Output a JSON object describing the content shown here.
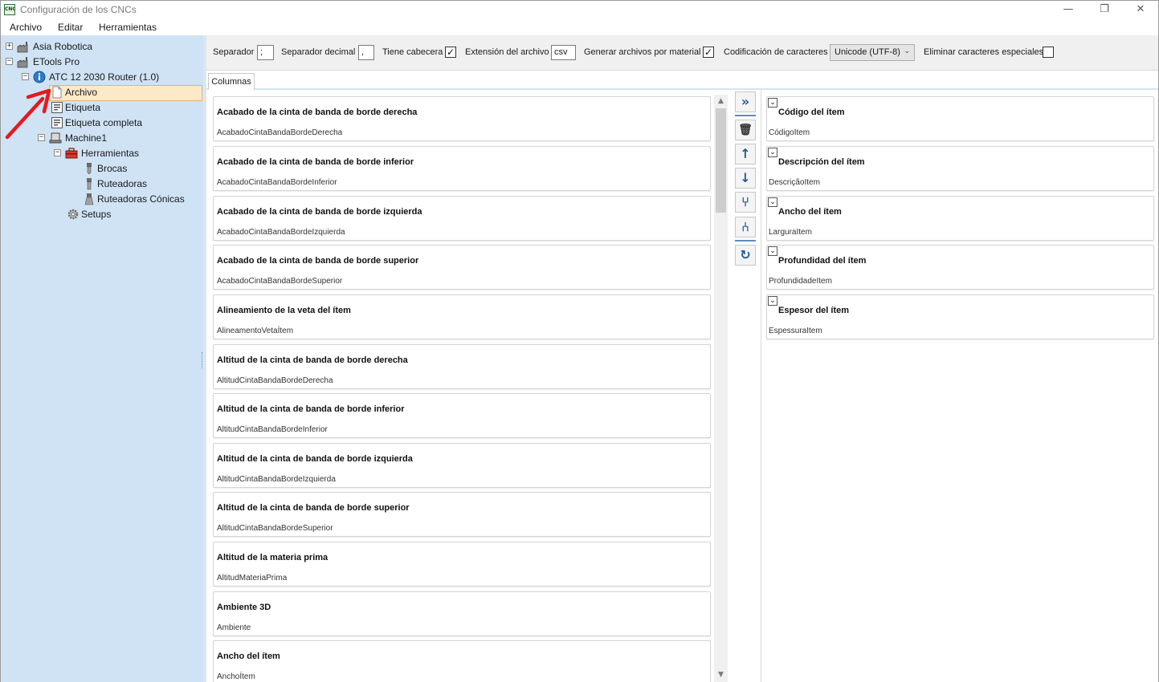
{
  "window": {
    "title": "Configuración de los CNCs",
    "app_icon": "CNC",
    "minimize": "—",
    "restore": "❐",
    "close": "✕"
  },
  "menu": [
    "Archivo",
    "Editar",
    "Herramientas"
  ],
  "tree": {
    "asia": "Asia Robotica",
    "etools": "ETools Pro",
    "atc": "ATC 12 2030 Router (1.0)",
    "archivo": "Archivo",
    "etiqueta": "Etiqueta",
    "etiqueta_completa": "Etiqueta completa",
    "machine1": "Machine1",
    "herramientas": "Herramientas",
    "brocas": "Brocas",
    "ruteadoras": "Ruteadoras",
    "ruteadoras_conicas": "Ruteadoras Cónicas",
    "setups": "Setups"
  },
  "toolbar": {
    "separador_label": "Separador",
    "separador_value": ";",
    "decimal_label": "Separador decimal",
    "decimal_value": ",",
    "cabecera_label": "Tiene cabecera",
    "cabecera_checked": "✓",
    "extension_label": "Extensión del archivo",
    "extension_value": "csv",
    "por_material_label": "Generar archivos por material",
    "por_material_checked": "✓",
    "codificacion_label": "Codificación de caracteres",
    "codificacion_value": "Unicode (UTF-8)",
    "eliminar_label": "Eliminar caracteres especiales",
    "eliminar_checked": ""
  },
  "tab": "Columnas",
  "available_columns": [
    {
      "title": "Acabado de la cinta de banda de borde derecha",
      "key": "AcabadoCintaBandaBordeDerecha"
    },
    {
      "title": "Acabado de la cinta de banda de borde inferior",
      "key": "AcabadoCintaBandaBordeInferior"
    },
    {
      "title": "Acabado de la cinta de banda de borde izquierda",
      "key": "AcabadoCintaBandaBordeIzquierda"
    },
    {
      "title": "Acabado de la cinta de banda de borde superior",
      "key": "AcabadoCintaBandaBordeSuperior"
    },
    {
      "title": "Alineamiento de la veta del ítem",
      "key": "AlineamentoVetaÍtem"
    },
    {
      "title": "Altitud de la cinta de banda de borde derecha",
      "key": "AltitudCintaBandaBordeDerecha"
    },
    {
      "title": "Altitud de la cinta de banda de borde inferior",
      "key": "AltitudCintaBandaBordeInferior"
    },
    {
      "title": "Altitud de la cinta de banda de borde izquierda",
      "key": "AltitudCintaBandaBordeIzquierda"
    },
    {
      "title": "Altitud de la cinta de banda de borde superior",
      "key": "AltitudCintaBandaBordeSuperior"
    },
    {
      "title": "Altitud de la materia prima",
      "key": "AltitudMateriaPrima"
    },
    {
      "title": "Ambiente 3D",
      "key": "Ambiente"
    },
    {
      "title": "Ancho del ítem",
      "key": "AnchoÍtem"
    }
  ],
  "selected_columns": [
    {
      "title": "Código del ítem",
      "key": "CódigoItem"
    },
    {
      "title": "Descripción del ítem",
      "key": "DescriçãoItem"
    },
    {
      "title": "Ancho del ítem",
      "key": "LarguraItem"
    },
    {
      "title": "Profundidad del ítem",
      "key": "ProfundidadeItem"
    },
    {
      "title": "Espesor del ítem",
      "key": "EspessuraItem"
    }
  ],
  "buttons": {
    "add": "»",
    "delete": "🗑",
    "up": "↑",
    "down": "↓",
    "merge": "⑂",
    "split": "⑃",
    "refresh": "↻"
  },
  "annotation_color": "#e5191e"
}
